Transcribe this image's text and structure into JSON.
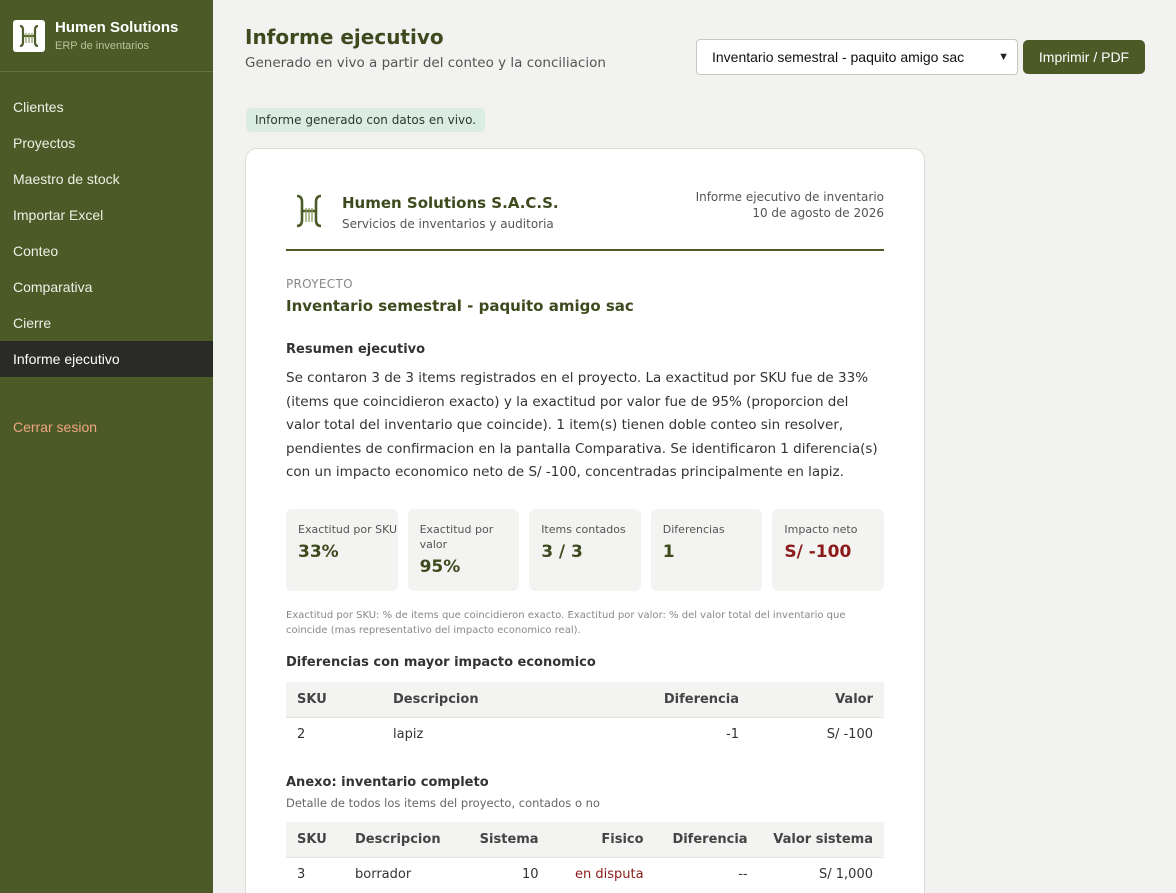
{
  "brand": {
    "name": "Humen Solutions",
    "sub": "ERP de inventarios"
  },
  "nav": {
    "items": [
      "Clientes",
      "Proyectos",
      "Maestro de stock",
      "Importar Excel",
      "Conteo",
      "Comparativa",
      "Cierre",
      "Informe ejecutivo"
    ],
    "active": "Informe ejecutivo",
    "logout": "Cerrar sesion"
  },
  "header": {
    "title": "Informe ejecutivo",
    "subtitle": "Generado en vivo a partir del conteo y la conciliacion",
    "project_select": "Inventario semestral - paquito amigo sac",
    "print_label": "Imprimir / PDF"
  },
  "notice": "Informe generado con datos en vivo.",
  "report": {
    "company": "Humen Solutions S.A.C.S.",
    "service": "Servicios de inventarios y auditoria",
    "kind": "Informe ejecutivo de inventario",
    "date": "10 de agosto de 2026",
    "project_label": "PROYECTO",
    "project_name": "Inventario semestral - paquito amigo sac",
    "summary_title": "Resumen ejecutivo",
    "summary_text": "Se contaron 3 de 3 items registrados en el proyecto. La exactitud por SKU fue de 33% (items que coincidieron exacto) y la exactitud por valor fue de 95% (proporcion del valor total del inventario que coincide). 1 item(s) tienen doble conteo sin resolver, pendientes de confirmacion en la pantalla Comparativa. Se identificaron 1 diferencia(s) con un impacto economico neto de S/ -100, concentradas principalmente en lapiz.",
    "kpis": {
      "sku": {
        "label": "Exactitud por SKU",
        "value": "33%"
      },
      "value": {
        "label": "Exactitud por valor",
        "value": "95%"
      },
      "counted": {
        "label": "Items contados",
        "value": "3 / 3"
      },
      "diffs": {
        "label": "Diferencias",
        "value": "1"
      },
      "impact": {
        "label": "Impacto neto",
        "value": "S/ -100"
      }
    },
    "kpi_note": "Exactitud por SKU: % de items que coincidieron exacto. Exactitud por valor: % del valor total del inventario que coincide (mas representativo del impacto economico real).",
    "diff_title": "Diferencias con mayor impacto economico",
    "diff_table": {
      "headers": {
        "sku": "SKU",
        "desc": "Descripcion",
        "diff": "Diferencia",
        "value": "Valor"
      },
      "rows": [
        {
          "sku": "2",
          "desc": "lapiz",
          "diff": "-1",
          "value": "S/ -100"
        }
      ]
    },
    "annex_title": "Anexo: inventario completo",
    "annex_sub": "Detalle de todos los items del proyecto, contados o no",
    "annex_table": {
      "headers": {
        "sku": "SKU",
        "desc": "Descripcion",
        "system": "Sistema",
        "physical": "Fisico",
        "diff": "Diferencia",
        "value": "Valor sistema"
      },
      "rows": [
        {
          "sku": "3",
          "desc": "borrador",
          "system": "10",
          "physical": "en disputa",
          "diff": "--",
          "value": "S/ 1,000"
        }
      ]
    }
  }
}
